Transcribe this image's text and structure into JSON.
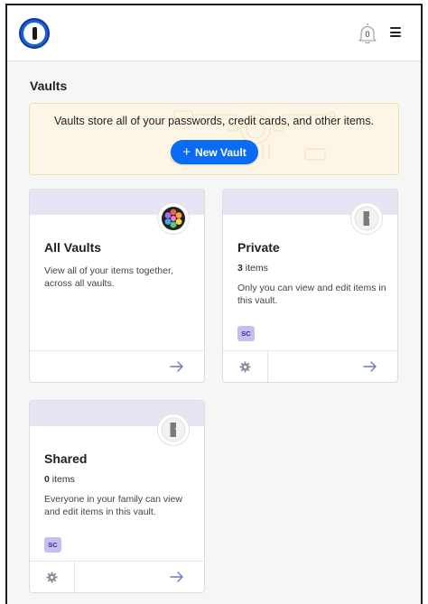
{
  "header": {
    "notification_count": "0"
  },
  "section_title": "Vaults",
  "banner": {
    "text": "Vaults store all of your passwords, credit cards, and other items.",
    "button_label": "New Vault"
  },
  "vaults": [
    {
      "name": "All Vaults",
      "count_number": "",
      "count_label": "",
      "description": "View all of your items together, across all vaults.",
      "badge": "",
      "icon": "rainbow-vault-icon"
    },
    {
      "name": "Private",
      "count_number": "3",
      "count_label": "items",
      "description": "Only you can view and edit items in this vault.",
      "badge": "SC",
      "icon": "keyhole-vault-icon"
    },
    {
      "name": "Shared",
      "count_number": "0",
      "count_label": "items",
      "description": "Everyone in your family can view and edit items in this vault.",
      "badge": "SC",
      "icon": "keyhole-vault-icon"
    }
  ],
  "colors": {
    "accent": "#0a6cf2",
    "banner_bg": "#fdf5e6",
    "card_header": "#e7e5f4",
    "badge_bg": "#c8bdf2",
    "arrow": "#6e79b8"
  },
  "icons": {
    "logo": "1password-logo-icon",
    "bell": "bell-icon",
    "menu": "hamburger-menu-icon",
    "settings": "gear-icon",
    "open": "arrow-right-icon"
  }
}
